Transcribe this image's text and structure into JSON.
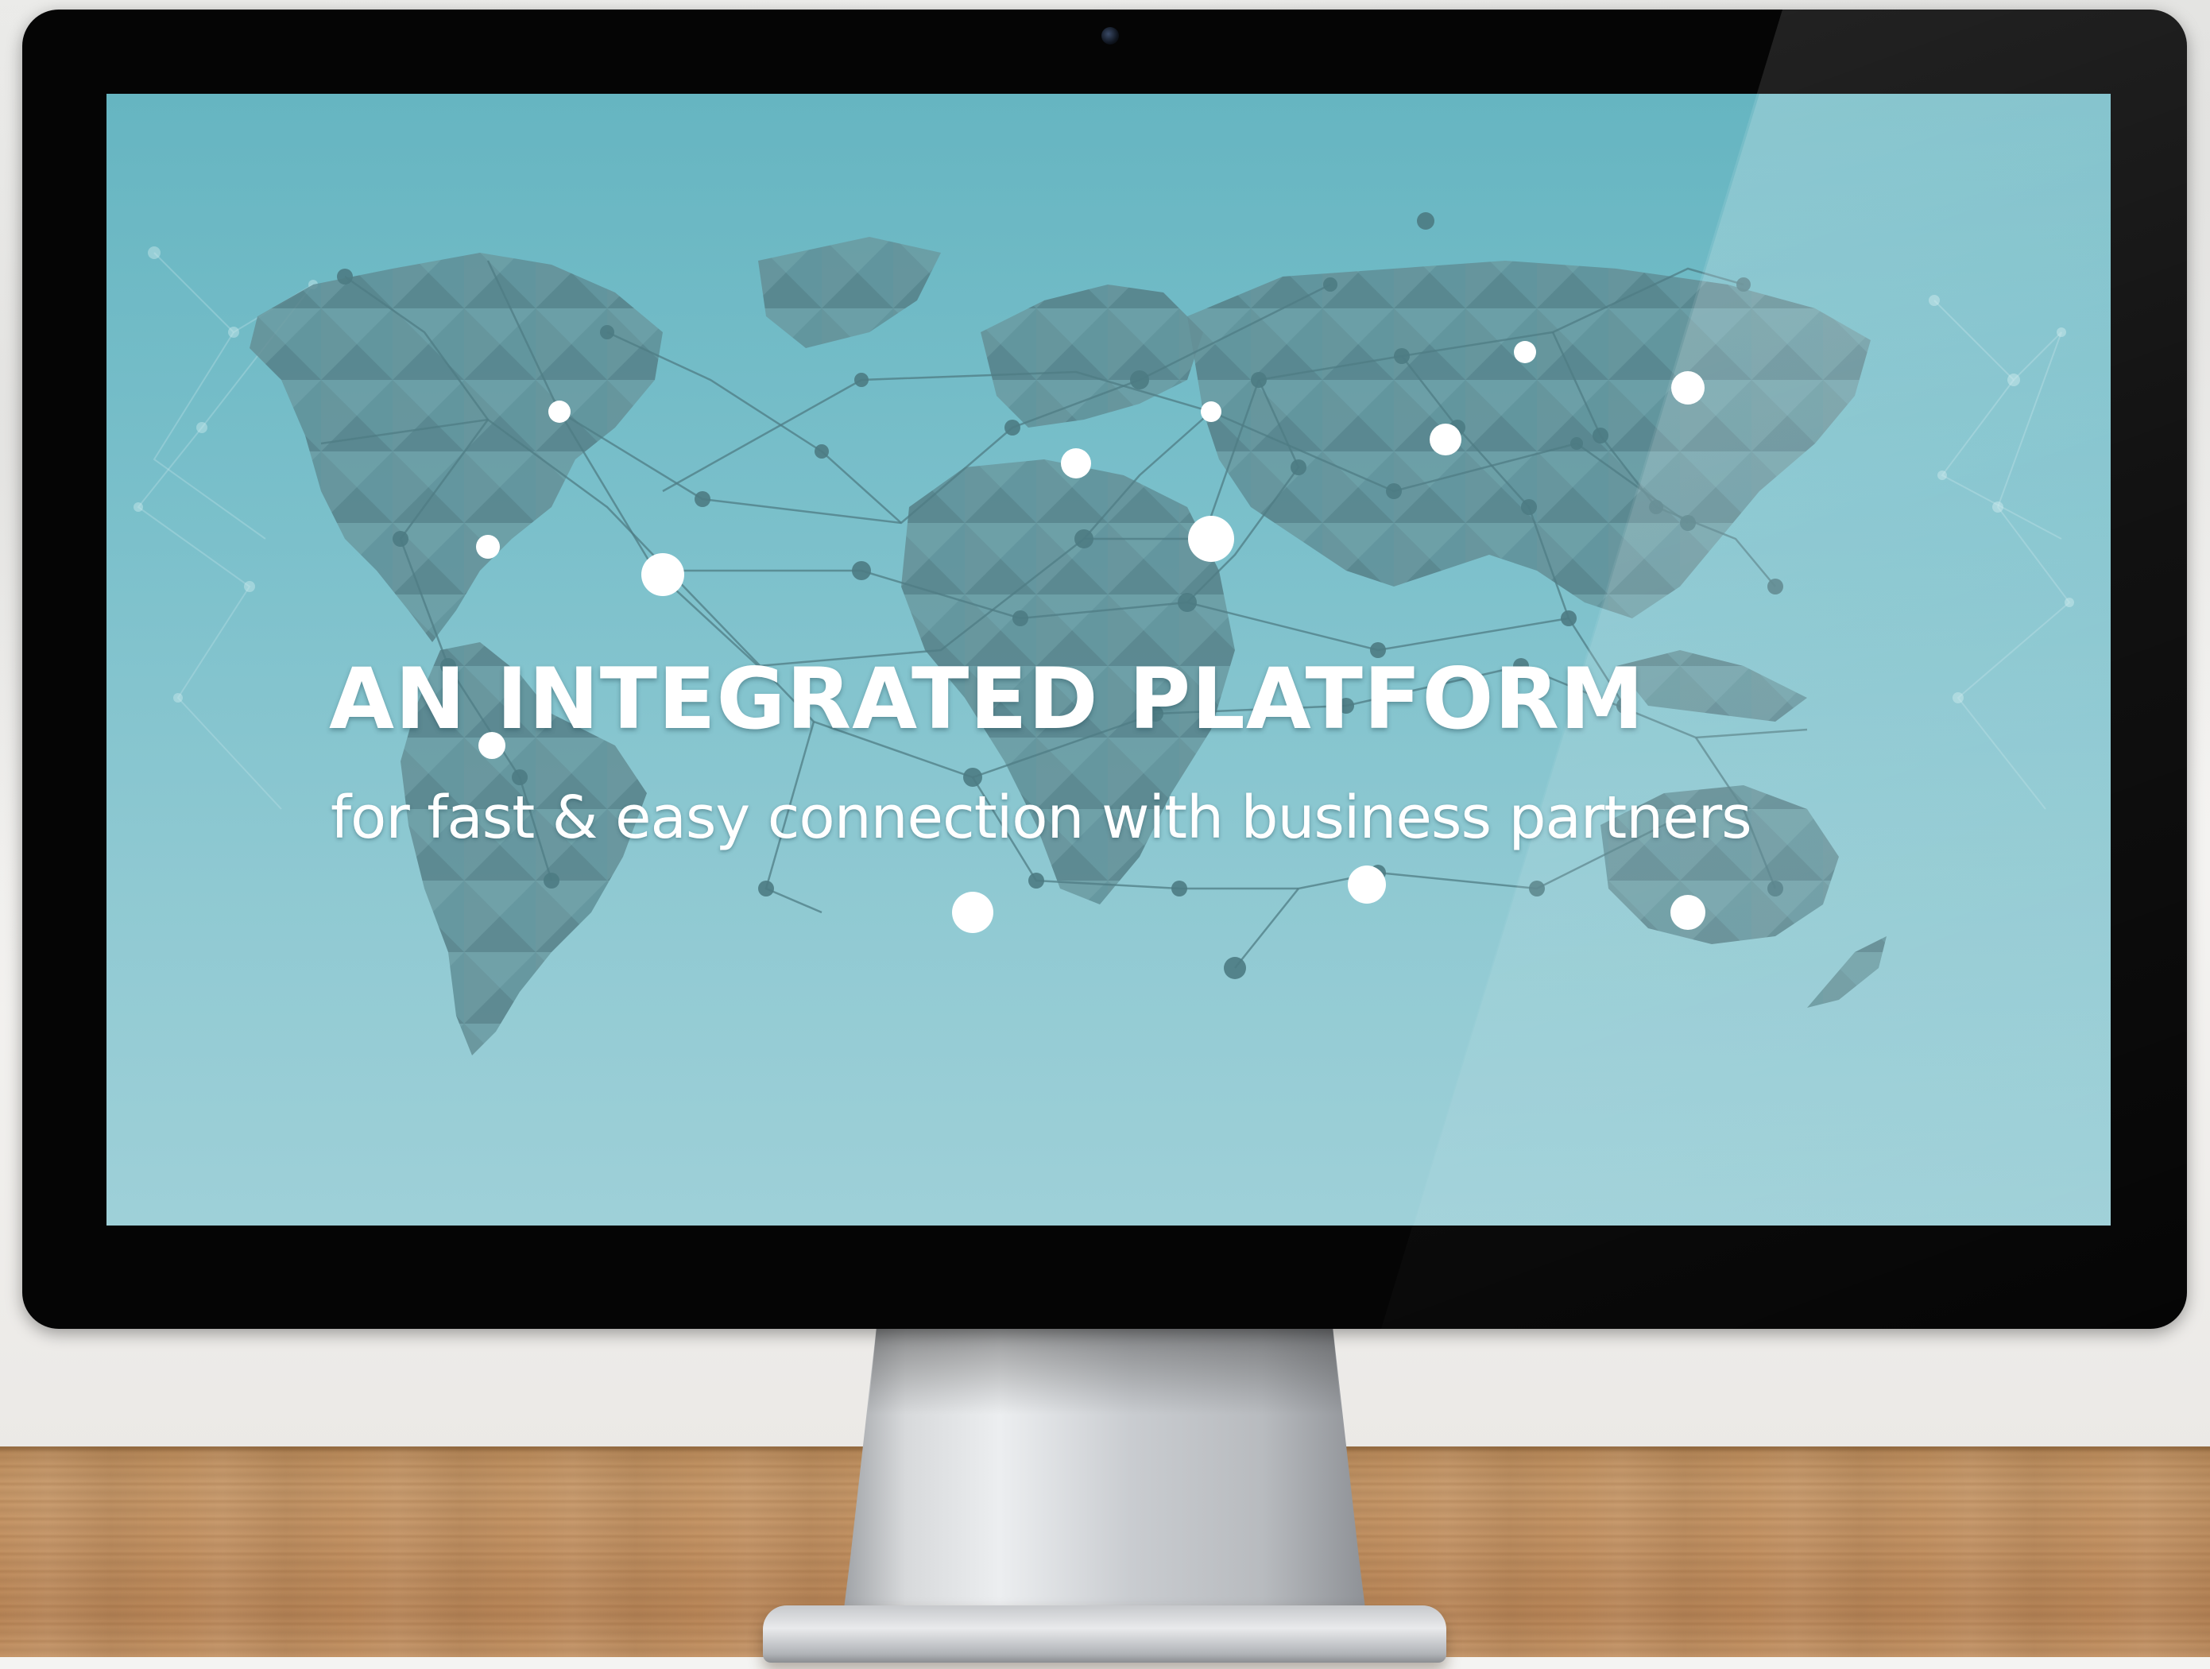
{
  "screen": {
    "headline": "AN INTEGRATED PLATFORM",
    "subheadline": "for fast & easy connection with business partners",
    "background_color": "#79bfca",
    "text_color": "#ffffff",
    "continent_color": "#5e8d95"
  },
  "scene": {
    "device": "desktop-monitor",
    "desk": "wooden-desk"
  }
}
